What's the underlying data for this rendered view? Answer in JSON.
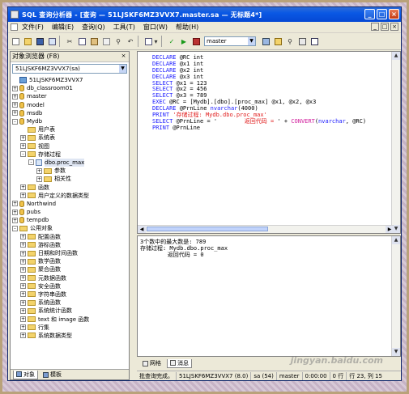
{
  "window": {
    "title": "SQL 查询分析器 - [查询 — 51LJSKF6MZ3VVX7.master.sa — 无标题4*]",
    "min": "_",
    "max": "□",
    "close": "×"
  },
  "menu": {
    "items": [
      "文件(F)",
      "编辑(E)",
      "查询(Q)",
      "工具(T)",
      "窗口(W)",
      "帮助(H)"
    ],
    "doc_controls": [
      "_",
      "□",
      "×"
    ]
  },
  "toolbar": {
    "database": "master",
    "icons": [
      "new-query-icon",
      "open-icon",
      "save-icon",
      "insert-template-icon",
      "cut-icon",
      "copy-icon",
      "paste-icon",
      "clear-icon",
      "find-icon",
      "undo-icon",
      "dropdown-icon",
      "execute-mode-icon",
      "check-icon",
      "execute-icon",
      "stop-icon",
      "object-browser-icon",
      "object-search-icon",
      "show-plan-icon",
      "results-pane-icon"
    ]
  },
  "object_browser": {
    "title": "对象浏览器 (F8)",
    "close": "×",
    "server": "51LJSKF6MZ3VVX7(sa)",
    "tree": [
      {
        "depth": 0,
        "exp": "",
        "icon": "srv",
        "label": "51LJSKF6MZ3VVX7"
      },
      {
        "depth": 0,
        "exp": "+",
        "icon": "db",
        "label": "db_classroom01"
      },
      {
        "depth": 0,
        "exp": "+",
        "icon": "db",
        "label": "master"
      },
      {
        "depth": 0,
        "exp": "+",
        "icon": "db",
        "label": "model"
      },
      {
        "depth": 0,
        "exp": "+",
        "icon": "db",
        "label": "msdb"
      },
      {
        "depth": 0,
        "exp": "-",
        "icon": "db",
        "label": "Mydb"
      },
      {
        "depth": 1,
        "exp": "",
        "icon": "fold",
        "label": "用户表"
      },
      {
        "depth": 1,
        "exp": "+",
        "icon": "fold",
        "label": "系统表"
      },
      {
        "depth": 1,
        "exp": "+",
        "icon": "fold",
        "label": "视图"
      },
      {
        "depth": 1,
        "exp": "-",
        "icon": "fold",
        "label": "存储过程"
      },
      {
        "depth": 2,
        "exp": "-",
        "icon": "proc",
        "label": "dbo.proc_max",
        "selected": true
      },
      {
        "depth": 3,
        "exp": "+",
        "icon": "fold",
        "label": "参数"
      },
      {
        "depth": 3,
        "exp": "+",
        "icon": "fold",
        "label": "相关性"
      },
      {
        "depth": 1,
        "exp": "+",
        "icon": "fold",
        "label": "函数"
      },
      {
        "depth": 1,
        "exp": "+",
        "icon": "fold",
        "label": "用户定义的数据类型"
      },
      {
        "depth": 0,
        "exp": "+",
        "icon": "db",
        "label": "Northwind"
      },
      {
        "depth": 0,
        "exp": "+",
        "icon": "db",
        "label": "pubs"
      },
      {
        "depth": 0,
        "exp": "+",
        "icon": "db",
        "label": "tempdb"
      },
      {
        "depth": 0,
        "exp": "-",
        "icon": "fold",
        "label": "公用对象"
      },
      {
        "depth": 1,
        "exp": "+",
        "icon": "fold",
        "label": "配置函数"
      },
      {
        "depth": 1,
        "exp": "+",
        "icon": "fold",
        "label": "游标函数"
      },
      {
        "depth": 1,
        "exp": "+",
        "icon": "fold",
        "label": "日期和时间函数"
      },
      {
        "depth": 1,
        "exp": "+",
        "icon": "fold",
        "label": "数学函数"
      },
      {
        "depth": 1,
        "exp": "+",
        "icon": "fold",
        "label": "聚合函数"
      },
      {
        "depth": 1,
        "exp": "+",
        "icon": "fold",
        "label": "元数据函数"
      },
      {
        "depth": 1,
        "exp": "+",
        "icon": "fold",
        "label": "安全函数"
      },
      {
        "depth": 1,
        "exp": "+",
        "icon": "fold",
        "label": "字符串函数"
      },
      {
        "depth": 1,
        "exp": "+",
        "icon": "fold",
        "label": "系统函数"
      },
      {
        "depth": 1,
        "exp": "+",
        "icon": "fold",
        "label": "系统统计函数"
      },
      {
        "depth": 1,
        "exp": "+",
        "icon": "fold",
        "label": "text 和 image 函数"
      },
      {
        "depth": 1,
        "exp": "+",
        "icon": "fold",
        "label": "行集"
      },
      {
        "depth": 1,
        "exp": "+",
        "icon": "fold",
        "label": "系统数据类型"
      }
    ],
    "tabs": [
      "对象",
      "模板"
    ]
  },
  "editor": {
    "lines": [
      [
        [
          "kw",
          "DECLARE "
        ],
        [
          "",
          "@RC int"
        ]
      ],
      [
        [
          "kw",
          "DECLARE "
        ],
        [
          "",
          "@x1 int"
        ]
      ],
      [
        [
          "kw",
          "DECLARE "
        ],
        [
          "",
          "@x2 int"
        ]
      ],
      [
        [
          "kw",
          "DECLARE "
        ],
        [
          "",
          "@x3 int"
        ]
      ],
      [
        [
          "kw",
          "SELECT "
        ],
        [
          "",
          "@x1 = 123"
        ]
      ],
      [
        [
          "kw",
          "SELECT "
        ],
        [
          "",
          "@x2 = 456"
        ]
      ],
      [
        [
          "kw",
          "SELECT "
        ],
        [
          "",
          "@x3 = 789"
        ]
      ],
      [
        [
          "kw",
          "EXEC "
        ],
        [
          "",
          "@RC = [Mydb].[dbo].[proc_max] @x1, @x2, @x3"
        ]
      ],
      [
        [
          "kw",
          "DECLARE "
        ],
        [
          "",
          "@PrnLine "
        ],
        [
          "kw",
          "nvarchar"
        ],
        [
          "",
          "(4000)"
        ]
      ],
      [
        [
          "kw",
          "PRINT "
        ],
        [
          "str",
          "'存储过程: Mydb.dbo.proc_max'"
        ]
      ],
      [
        [
          "kw",
          "SELECT "
        ],
        [
          "",
          "@PrnLine = '"
        ],
        [
          "str",
          "        返回代码 = "
        ],
        [
          "",
          "' + "
        ],
        [
          "fn",
          "CONVERT"
        ],
        [
          "",
          "("
        ],
        [
          "kw",
          "nvarchar"
        ],
        [
          "",
          ", @RC)"
        ]
      ],
      [
        [
          "kw",
          "PRINT "
        ],
        [
          "",
          "@PrnLine"
        ]
      ]
    ]
  },
  "results": {
    "lines": [
      "3个数中的最大数是: 789",
      "存储过程: Mydb.dbo.proc_max",
      "        返回代码 = 0"
    ],
    "tabs": [
      "网格",
      "消息"
    ]
  },
  "status": {
    "message": "批查询完成。",
    "server": "51LJSKF6MZ3VVX7 (8.0)",
    "user": "sa (54)",
    "database": "master",
    "time": "0:00:00",
    "rows": "0 行",
    "position": "行 23, 列 15"
  },
  "watermark": "jingyan.baidu.com"
}
